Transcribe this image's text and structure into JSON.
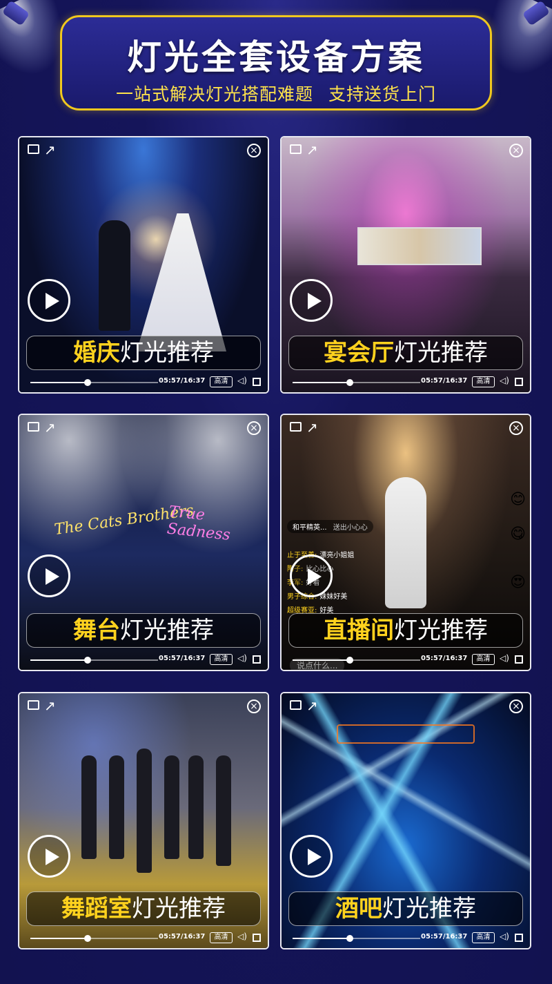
{
  "header": {
    "title": "灯光全套设备方案",
    "subtitle_left": "一站式解决灯光搭配难题",
    "subtitle_right": "支持送货上门"
  },
  "cards": [
    {
      "highlight": "婚庆",
      "rest": "灯光推荐",
      "time": "05:57/16:37",
      "quality": "高清",
      "progress": 0.45
    },
    {
      "highlight": "宴会厅",
      "rest": "灯光推荐",
      "time": "05:57/16:37",
      "quality": "高清",
      "progress": 0.45
    },
    {
      "highlight": "舞台",
      "rest": "灯光推荐",
      "time": "05:57/16:37",
      "quality": "高清",
      "progress": 0.45
    },
    {
      "highlight": "直播间",
      "rest": "灯光推荐",
      "time": "05:57/16:37",
      "quality": "高清",
      "progress": 0.45
    },
    {
      "highlight": "舞蹈室",
      "rest": "灯光推荐",
      "time": "05:57/16:37",
      "quality": "高清",
      "progress": 0.45
    },
    {
      "highlight": "酒吧",
      "rest": "灯光推荐",
      "time": "05:57/16:37",
      "quality": "高清",
      "progress": 0.45
    }
  ],
  "stage_scene": {
    "neon_left": "The Cats Brothers",
    "neon_right": "True Sadness"
  },
  "live_chat": {
    "host": "和平精英...",
    "host_sub": "送出小心心",
    "lines": [
      {
        "user": "止于至善:",
        "text": "漂亮小姐姐"
      },
      {
        "user": "陶子:",
        "text": "比心比心"
      },
      {
        "user": "李军:",
        "text": "好看"
      },
      {
        "user": "男子综合:",
        "text": "妹妹好美"
      },
      {
        "user": "超级赛亚:",
        "text": "好美"
      }
    ],
    "input_placeholder": "说点什么..."
  },
  "icons": [
    "airplay-icon",
    "share-icon",
    "close-icon",
    "play-icon",
    "volume-icon",
    "fullscreen-icon"
  ],
  "colors": {
    "highlight": "#ffd21e",
    "frame": "#f0c81e",
    "background": "#15155a"
  }
}
